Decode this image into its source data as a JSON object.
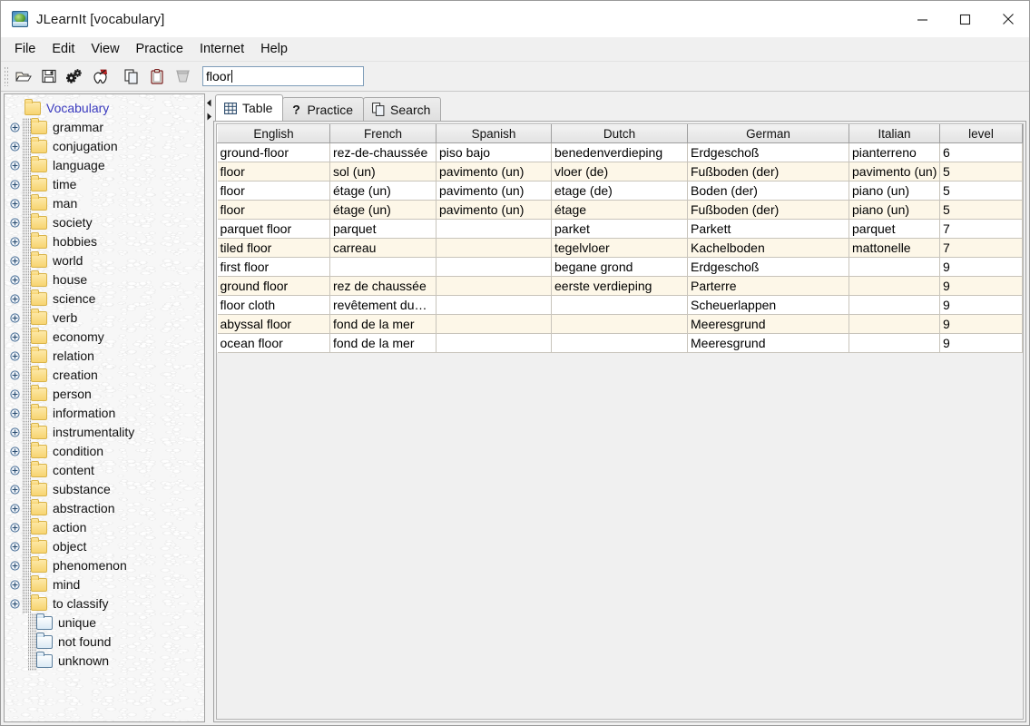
{
  "window": {
    "title": "JLearnIt [vocabulary]",
    "icon": "book-globe-icon",
    "minimize": "minimize-icon",
    "maximize": "maximize-icon",
    "close": "close-icon"
  },
  "menubar": {
    "items": [
      {
        "label": "File"
      },
      {
        "label": "Edit"
      },
      {
        "label": "View"
      },
      {
        "label": "Practice"
      },
      {
        "label": "Internet"
      },
      {
        "label": "Help"
      }
    ]
  },
  "toolbar": {
    "buttons": [
      {
        "name": "open-icon",
        "title": "Open"
      },
      {
        "name": "save-icon",
        "title": "Save"
      },
      {
        "name": "settings-icon",
        "title": "Settings"
      },
      {
        "name": "extract-icon",
        "title": "Extract"
      },
      {
        "name": "copy-icon",
        "title": "Copy"
      },
      {
        "name": "paste-icon",
        "title": "Paste"
      },
      {
        "name": "delete-icon",
        "title": "Delete"
      }
    ],
    "search": {
      "value": "floor",
      "placeholder": ""
    }
  },
  "tree": {
    "root": {
      "label": "Vocabulary",
      "folder": "yellow"
    },
    "items": [
      {
        "label": "grammar",
        "folder": "yellow",
        "expandable": true
      },
      {
        "label": "conjugation",
        "folder": "yellow",
        "expandable": true
      },
      {
        "label": "language",
        "folder": "yellow",
        "expandable": true
      },
      {
        "label": "time",
        "folder": "yellow",
        "expandable": true
      },
      {
        "label": "man",
        "folder": "yellow",
        "expandable": true
      },
      {
        "label": "society",
        "folder": "yellow",
        "expandable": true
      },
      {
        "label": "hobbies",
        "folder": "yellow",
        "expandable": true
      },
      {
        "label": "world",
        "folder": "yellow",
        "expandable": true
      },
      {
        "label": "house",
        "folder": "yellow",
        "expandable": true
      },
      {
        "label": "science",
        "folder": "yellow",
        "expandable": true
      },
      {
        "label": "verb",
        "folder": "yellow",
        "expandable": true
      },
      {
        "label": "economy",
        "folder": "yellow",
        "expandable": true
      },
      {
        "label": "relation",
        "folder": "yellow",
        "expandable": true
      },
      {
        "label": "creation",
        "folder": "yellow",
        "expandable": true
      },
      {
        "label": "person",
        "folder": "yellow",
        "expandable": true
      },
      {
        "label": "information",
        "folder": "yellow",
        "expandable": true
      },
      {
        "label": "instrumentality",
        "folder": "yellow",
        "expandable": true
      },
      {
        "label": "condition",
        "folder": "yellow",
        "expandable": true
      },
      {
        "label": "content",
        "folder": "yellow",
        "expandable": true
      },
      {
        "label": "substance",
        "folder": "yellow",
        "expandable": true
      },
      {
        "label": "abstraction",
        "folder": "yellow",
        "expandable": true
      },
      {
        "label": "action",
        "folder": "yellow",
        "expandable": true
      },
      {
        "label": "object",
        "folder": "yellow",
        "expandable": true
      },
      {
        "label": "phenomenon",
        "folder": "yellow",
        "expandable": true
      },
      {
        "label": "mind",
        "folder": "yellow",
        "expandable": true
      },
      {
        "label": "to classify",
        "folder": "yellow",
        "expandable": true
      },
      {
        "label": "unique",
        "folder": "blue",
        "expandable": false
      },
      {
        "label": "not found",
        "folder": "blue",
        "expandable": false
      },
      {
        "label": "unknown",
        "folder": "blue",
        "expandable": false
      }
    ]
  },
  "tabs": [
    {
      "label": "Table",
      "icon": "grid-icon",
      "active": true
    },
    {
      "label": "Practice",
      "icon": "question-icon",
      "active": false
    },
    {
      "label": "Search",
      "icon": "pages-icon",
      "active": false
    }
  ],
  "table": {
    "columns": [
      "English",
      "French",
      "Spanish",
      "Dutch",
      "German",
      "Italian",
      "level"
    ],
    "rows": [
      [
        "ground-floor",
        "rez-de-chaussée",
        "piso bajo",
        "benedenverdieping",
        "Erdgeschoß",
        "pianterreno",
        "6"
      ],
      [
        "floor",
        "sol (un)",
        "pavimento (un)",
        "vloer (de)",
        "Fußboden (der)",
        "pavimento (un)",
        "5"
      ],
      [
        "floor",
        "étage (un)",
        "pavimento (un)",
        "etage (de)",
        "Boden (der)",
        "piano (un)",
        "5"
      ],
      [
        "floor",
        "étage (un)",
        "pavimento (un)",
        "étage",
        "Fußboden (der)",
        "piano (un)",
        "5"
      ],
      [
        "parquet floor",
        "parquet",
        "",
        "parket",
        "Parkett",
        "parquet",
        "7"
      ],
      [
        "tiled floor",
        "carreau",
        "",
        "tegelvloer",
        "Kachelboden",
        "mattonelle",
        "7"
      ],
      [
        "first floor",
        "",
        "",
        "begane grond",
        "Erdgeschoß",
        "",
        "9"
      ],
      [
        "ground floor",
        "rez de chaussée",
        "",
        "eerste verdieping",
        "Parterre",
        "",
        "9"
      ],
      [
        "floor cloth",
        "revêtement du…",
        "",
        "",
        "Scheuerlappen",
        "",
        "9"
      ],
      [
        "abyssal floor",
        "fond de la mer",
        "",
        "",
        "Meeresgrund",
        "",
        "9"
      ],
      [
        "ocean floor",
        "fond de la mer",
        "",
        "",
        "Meeresgrund",
        "",
        "9"
      ]
    ]
  },
  "colors": {
    "row_alt": "#fdf7e8",
    "root_label": "#3b3bbf",
    "folder_yellow": "#f7d471",
    "folder_blue": "#dbeaf5",
    "chrome": "#f0f0f0"
  }
}
